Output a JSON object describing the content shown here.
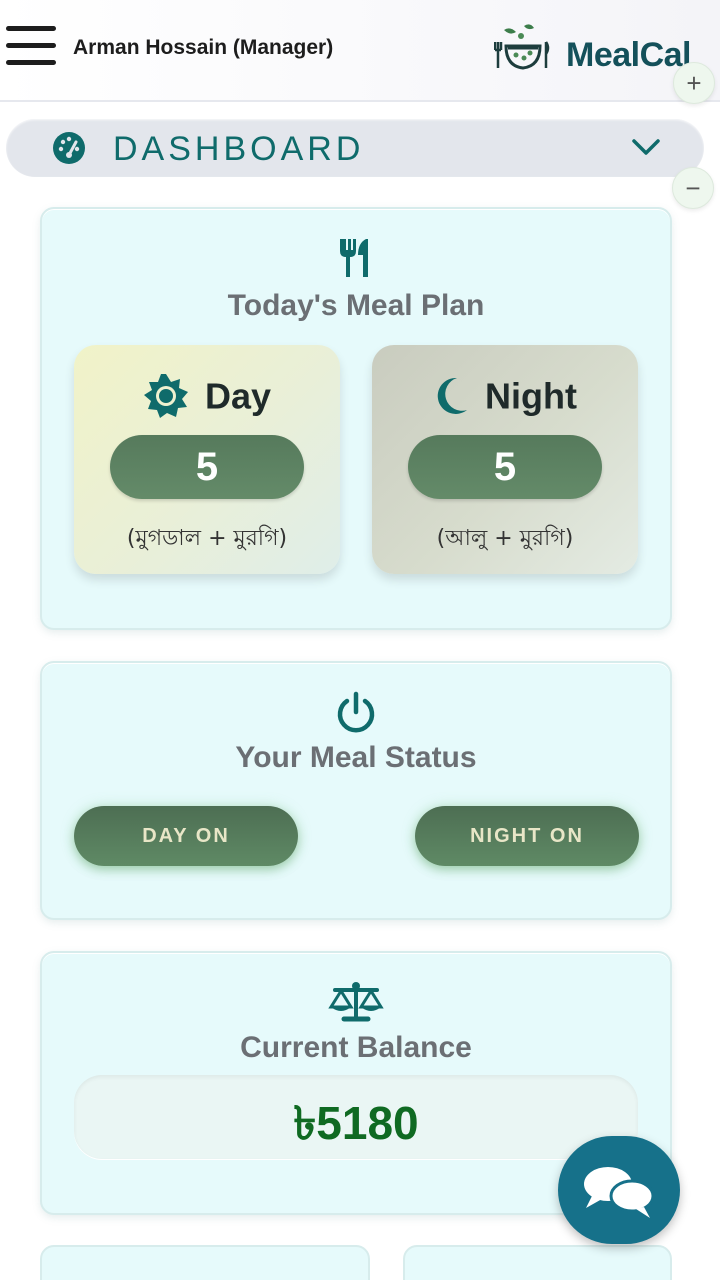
{
  "header": {
    "user_label": "Arman Hossain (Manager)",
    "brand": "MealCal",
    "zoom_in": "+",
    "zoom_out": "−"
  },
  "nav": {
    "section": "DASHBOARD"
  },
  "meal_plan": {
    "title": "Today's Meal Plan",
    "day": {
      "label": "Day",
      "count": "5",
      "menu": "(মুগডাল + মুরগি)"
    },
    "night": {
      "label": "Night",
      "count": "5",
      "menu": "(আলু + মুরগি)"
    }
  },
  "meal_status": {
    "title": "Your Meal Status",
    "day_button": "DAY ON",
    "night_button": "NIGHT ON"
  },
  "balance": {
    "title": "Current Balance",
    "value": "৳5180"
  },
  "colors": {
    "teal": "#0f6b6b",
    "green_pill": "#5f8a65",
    "balance_green": "#0f6a22",
    "fab": "#16718a"
  }
}
